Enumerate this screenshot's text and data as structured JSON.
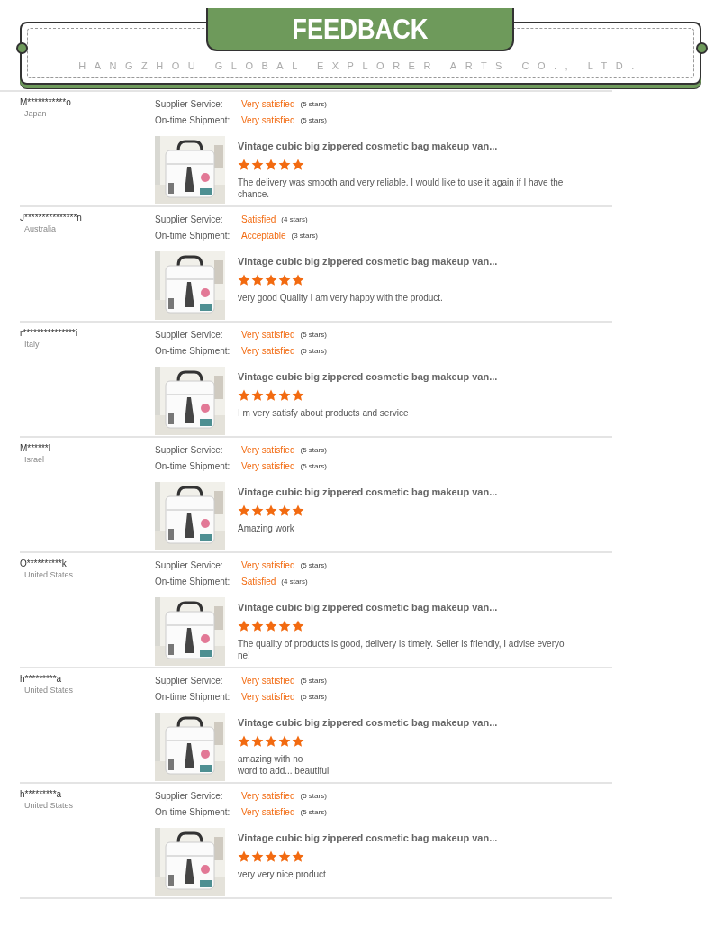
{
  "header": {
    "title": "FEEDBACK",
    "company": "HANGZHOU GLOBAL EXPLORER ARTS CO., LTD."
  },
  "reviews": [
    {
      "buyer": "M***********o",
      "country": "Japan",
      "ratings": [
        {
          "label": "Supplier Service:",
          "value": "Very satisfied",
          "stars_text": "(5 stars)"
        },
        {
          "label": "On-time Shipment:",
          "value": "Very satisfied",
          "stars_text": "(5 stars)"
        }
      ],
      "product": {
        "kind": "picture",
        "title": "Vintage cubic big zippered cosmetic bag makeup van..."
      },
      "stars": 5,
      "comment": "The delivery was smooth and very reliable. I would like to use it again if I have the chance."
    },
    {
      "buyer": "J***************n",
      "country": "Australia",
      "ratings": [
        {
          "label": "Supplier Service:",
          "value": "Satisfied",
          "stars_text": "(4 stars)"
        },
        {
          "label": "On-time Shipment:",
          "value": "Acceptable",
          "stars_text": "(3 stars)"
        }
      ],
      "product": {
        "kind": "picture",
        "title": "Vintage cubic big zippered cosmetic bag makeup van..."
      },
      "stars": 5,
      "comment": "very good Quality I am very happy with the product."
    },
    {
      "buyer": "r***************i",
      "country": "Italy",
      "ratings": [
        {
          "label": "Supplier Service:",
          "value": "Very satisfied",
          "stars_text": "(5 stars)"
        },
        {
          "label": "On-time Shipment:",
          "value": "Very satisfied",
          "stars_text": "(5 stars)"
        }
      ],
      "product": {
        "kind": "picture",
        "title": "Vintage cubic big zippered cosmetic bag makeup van..."
      },
      "stars": 5,
      "comment": "I m very satisfy about products and service"
    },
    {
      "buyer": "M******l",
      "country": "Israel",
      "ratings": [
        {
          "label": "Supplier Service:",
          "value": "Very satisfied",
          "stars_text": "(5 stars)"
        },
        {
          "label": "On-time Shipment:",
          "value": "Very satisfied",
          "stars_text": "(5 stars)"
        }
      ],
      "product": {
        "kind": "picture",
        "title": "Vintage cubic big zippered cosmetic bag makeup van..."
      },
      "stars": 5,
      "comment": "Amazing work"
    },
    {
      "buyer": "O**********k",
      "country": "United States",
      "ratings": [
        {
          "label": "Supplier Service:",
          "value": "Very satisfied",
          "stars_text": "(5 stars)"
        },
        {
          "label": "On-time Shipment:",
          "value": "Satisfied",
          "stars_text": "(4 stars)"
        }
      ],
      "product": {
        "kind": "picture",
        "title": "Vintage cubic big zippered cosmetic bag makeup van..."
      },
      "stars": 5,
      "comment": "The quality of products is good, delivery is timely. Seller is friendly, I advise everyo\nne!"
    },
    {
      "buyer": "h*********a",
      "country": "United States",
      "ratings": [
        {
          "label": "Supplier Service:",
          "value": "Very satisfied",
          "stars_text": "(5 stars)"
        },
        {
          "label": "On-time Shipment:",
          "value": "Very satisfied",
          "stars_text": "(5 stars)"
        }
      ],
      "product": {
        "kind": "picture",
        "title": "Vintage cubic big zippered cosmetic bag makeup van..."
      },
      "stars": 5,
      "comment": "amazing with no\nword to add... beautiful"
    },
    {
      "buyer": "h*********a",
      "country": "United States",
      "ratings": [
        {
          "label": "Supplier Service:",
          "value": "Very satisfied",
          "stars_text": "(5 stars)"
        },
        {
          "label": "On-time Shipment:",
          "value": "Very satisfied",
          "stars_text": "(5 stars)"
        }
      ],
      "product": {
        "kind": "picture",
        "title": "Vintage cubic big zippered cosmetic bag makeup van..."
      },
      "stars": 5,
      "comment": "very very nice product"
    }
  ]
}
